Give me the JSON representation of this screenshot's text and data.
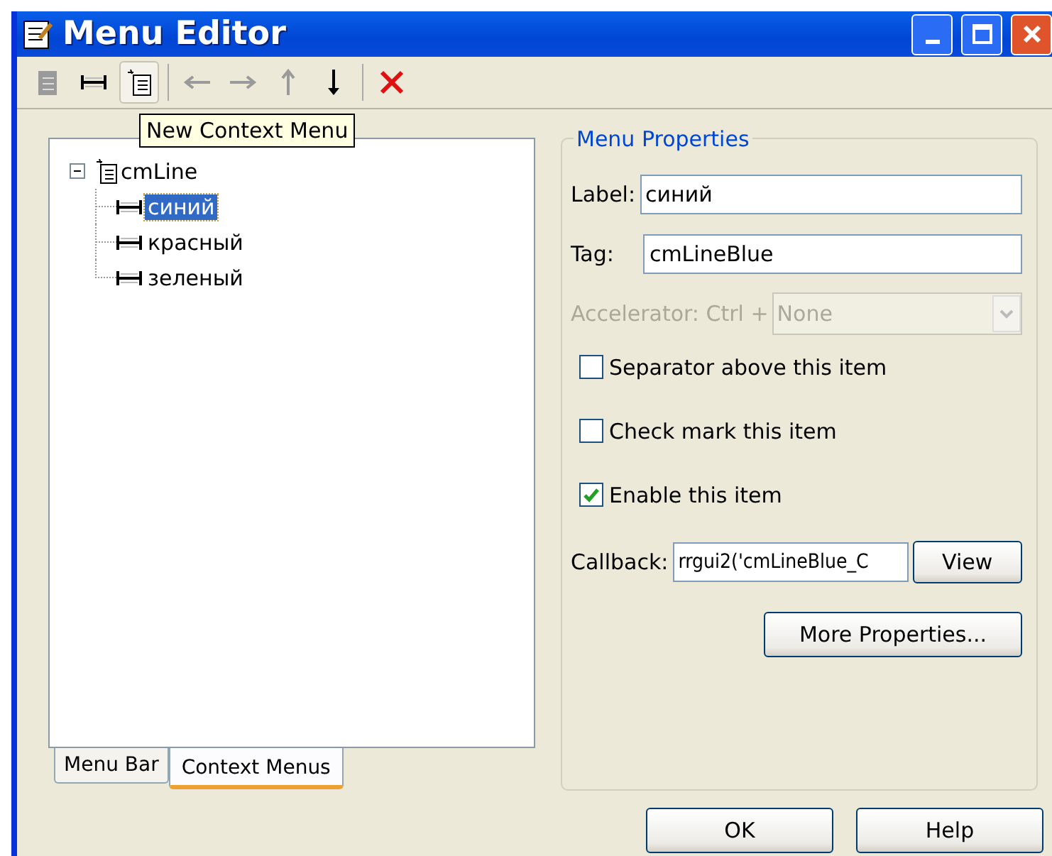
{
  "window": {
    "title": "Menu Editor"
  },
  "toolbar": [
    {
      "kind": "new-menu",
      "disabled": true,
      "pressed": false
    },
    {
      "kind": "new-item",
      "disabled": false,
      "pressed": false
    },
    {
      "kind": "new-context",
      "disabled": false,
      "pressed": true
    },
    {
      "kind": "sep"
    },
    {
      "kind": "left",
      "disabled": true,
      "pressed": false
    },
    {
      "kind": "right",
      "disabled": true,
      "pressed": false
    },
    {
      "kind": "up",
      "disabled": true,
      "pressed": false
    },
    {
      "kind": "down",
      "disabled": false,
      "pressed": false
    },
    {
      "kind": "sep"
    },
    {
      "kind": "delete",
      "disabled": false,
      "pressed": false
    }
  ],
  "tooltip": "New Context Menu",
  "tree": {
    "label": "cmLine",
    "expanded": true,
    "children": [
      {
        "label": "синий",
        "selected": true
      },
      {
        "label": "красный",
        "selected": false
      },
      {
        "label": "зеленый",
        "selected": false
      }
    ]
  },
  "tabs": [
    {
      "label": "Menu Bar",
      "selected": false
    },
    {
      "label": "Context Menus",
      "selected": true
    }
  ],
  "properties": {
    "title": "Menu Properties",
    "label": {
      "label": "Label:",
      "value": "синий"
    },
    "tag": {
      "label": "Tag:",
      "value": "cmLineBlue"
    },
    "accelerator": {
      "label": "Accelerator: Ctrl +",
      "value": "None",
      "disabled": true
    },
    "checkboxes": [
      {
        "label": "Separator above this item",
        "checked": false
      },
      {
        "label": "Check mark this item",
        "checked": false
      },
      {
        "label": "Enable this item",
        "checked": true
      }
    ],
    "callback": {
      "label": "Callback:",
      "value": "rrgui2('cmLineBlue_C"
    },
    "view_button": "View",
    "more_button": "More Properties..."
  },
  "buttons": [
    "OK",
    "Help"
  ]
}
